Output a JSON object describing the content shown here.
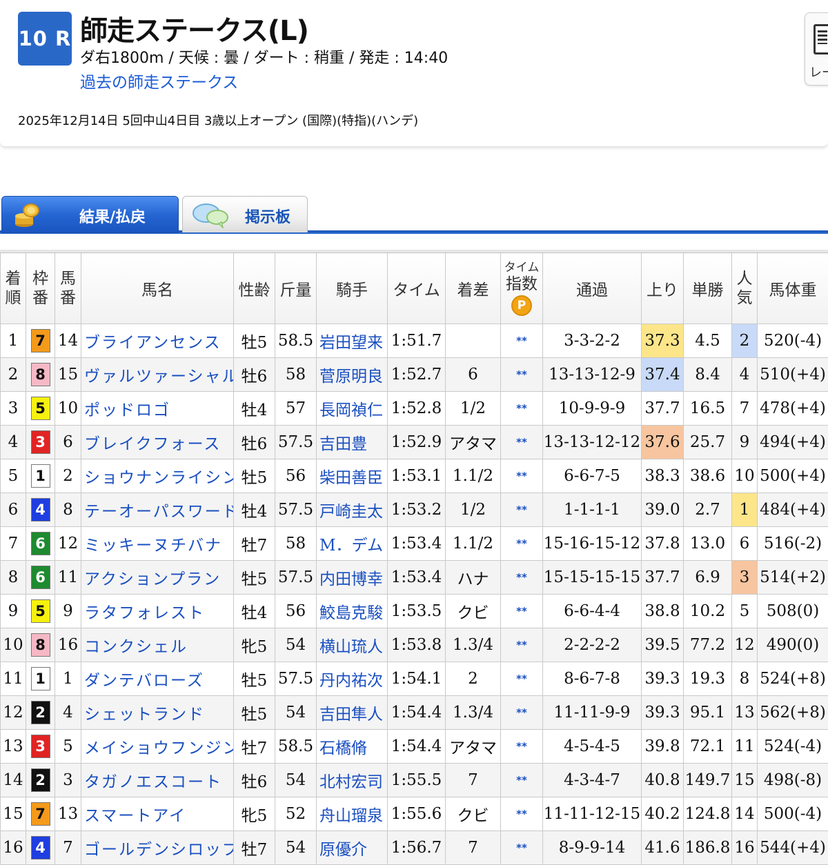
{
  "header": {
    "race_number": "10 R",
    "title": "師走ステークス(L)",
    "conditions": "ダ右1800m /  天候 : 曇 /  ダート : 稍重  /  発走 : 14:40",
    "past_link": "過去の師走ステークス",
    "meta": "2025年12月14日 5回中山4日目 3歳以上オープン  (国際)(特指)(ハンデ)",
    "side_widget_label": "レー"
  },
  "tabs": [
    {
      "label": "結果/払戻",
      "icon": "coins-icon",
      "active": true
    },
    {
      "label": "掲示板",
      "icon": "speech-bubble-icon",
      "active": false
    }
  ],
  "table": {
    "headers": {
      "rank": [
        "着",
        "順"
      ],
      "waku": [
        "枠",
        "番"
      ],
      "umaban": [
        "馬",
        "番"
      ],
      "horse": "馬名",
      "sex_age": "性齢",
      "weight": "斤量",
      "jockey": "騎手",
      "time": "タイム",
      "margin": "着差",
      "time_index": [
        "タイム",
        "指数"
      ],
      "time_index_badge": "P",
      "passing": "通過",
      "last3f": "上り",
      "odds": "単勝",
      "popularity": [
        "人",
        "気"
      ],
      "body_weight": "馬体重"
    },
    "highlight_colors": {
      "yellow": "#fde58a",
      "blue": "#c8daf8",
      "orange": "#f7c59f"
    },
    "rows": [
      {
        "rank": "1",
        "waku": "7",
        "umaban": "14",
        "horse": "ブライアンセンス",
        "sex_age": "牡5",
        "weight": "58.5",
        "jockey": "岩田望来",
        "time": "1:51.7",
        "margin": "",
        "index": "**",
        "passing": "3-3-2-2",
        "last3f": "37.3",
        "odds": "4.5",
        "pop": "2",
        "body": "520(-4)",
        "last3f_hl": "yellow",
        "pop_hl": "blue"
      },
      {
        "rank": "2",
        "waku": "8",
        "umaban": "15",
        "horse": "ヴァルツァーシャル",
        "sex_age": "牡6",
        "weight": "58",
        "jockey": "菅原明良",
        "time": "1:52.7",
        "margin": "6",
        "index": "**",
        "passing": "13-13-12-9",
        "last3f": "37.4",
        "odds": "8.4",
        "pop": "4",
        "body": "510(+4)",
        "last3f_hl": "blue",
        "pop_hl": ""
      },
      {
        "rank": "3",
        "waku": "5",
        "umaban": "10",
        "horse": "ポッドロゴ",
        "sex_age": "牡4",
        "weight": "57",
        "jockey": "長岡禎仁",
        "time": "1:52.8",
        "margin": "1/2",
        "index": "**",
        "passing": "10-9-9-9",
        "last3f": "37.7",
        "odds": "16.5",
        "pop": "7",
        "body": "478(+4)",
        "last3f_hl": "",
        "pop_hl": ""
      },
      {
        "rank": "4",
        "waku": "3",
        "umaban": "6",
        "horse": "ブレイクフォース",
        "sex_age": "牡6",
        "weight": "57.5",
        "jockey": "吉田豊",
        "time": "1:52.9",
        "margin": "アタマ",
        "index": "**",
        "passing": "13-13-12-12",
        "last3f": "37.6",
        "odds": "25.7",
        "pop": "9",
        "body": "494(+4)",
        "last3f_hl": "orange",
        "pop_hl": ""
      },
      {
        "rank": "5",
        "waku": "1",
        "umaban": "2",
        "horse": "ショウナンライシン",
        "sex_age": "牡5",
        "weight": "56",
        "jockey": "柴田善臣",
        "time": "1:53.1",
        "margin": "1.1/2",
        "index": "**",
        "passing": "6-6-7-5",
        "last3f": "38.3",
        "odds": "38.6",
        "pop": "10",
        "body": "500(+4)",
        "last3f_hl": "",
        "pop_hl": ""
      },
      {
        "rank": "6",
        "waku": "4",
        "umaban": "8",
        "horse": "テーオーパスワード",
        "sex_age": "牡4",
        "weight": "57.5",
        "jockey": "戸崎圭太",
        "time": "1:53.2",
        "margin": "1/2",
        "index": "**",
        "passing": "1-1-1-1",
        "last3f": "39.0",
        "odds": "2.7",
        "pop": "1",
        "body": "484(+4)",
        "last3f_hl": "",
        "pop_hl": "yellow"
      },
      {
        "rank": "7",
        "waku": "6",
        "umaban": "12",
        "horse": "ミッキーヌチバナ",
        "sex_age": "牡7",
        "weight": "58",
        "jockey": "M．デム",
        "time": "1:53.4",
        "margin": "1.1/2",
        "index": "**",
        "passing": "15-16-15-12",
        "last3f": "37.8",
        "odds": "13.0",
        "pop": "6",
        "body": "516(-2)",
        "last3f_hl": "",
        "pop_hl": ""
      },
      {
        "rank": "8",
        "waku": "6",
        "umaban": "11",
        "horse": "アクションプラン",
        "sex_age": "牡5",
        "weight": "57.5",
        "jockey": "内田博幸",
        "time": "1:53.4",
        "margin": "ハナ",
        "index": "**",
        "passing": "15-15-15-15",
        "last3f": "37.7",
        "odds": "6.9",
        "pop": "3",
        "body": "514(+2)",
        "last3f_hl": "",
        "pop_hl": "orange"
      },
      {
        "rank": "9",
        "waku": "5",
        "umaban": "9",
        "horse": "ラタフォレスト",
        "sex_age": "牡4",
        "weight": "56",
        "jockey": "鮫島克駿",
        "time": "1:53.5",
        "margin": "クビ",
        "index": "**",
        "passing": "6-6-4-4",
        "last3f": "38.8",
        "odds": "10.2",
        "pop": "5",
        "body": "508(0)",
        "last3f_hl": "",
        "pop_hl": ""
      },
      {
        "rank": "10",
        "waku": "8",
        "umaban": "16",
        "horse": "コンクシェル",
        "sex_age": "牝5",
        "weight": "54",
        "jockey": "横山琉人",
        "time": "1:53.8",
        "margin": "1.3/4",
        "index": "**",
        "passing": "2-2-2-2",
        "last3f": "39.5",
        "odds": "77.2",
        "pop": "12",
        "body": "490(0)",
        "last3f_hl": "",
        "pop_hl": ""
      },
      {
        "rank": "11",
        "waku": "1",
        "umaban": "1",
        "horse": "ダンテバローズ",
        "sex_age": "牡5",
        "weight": "57.5",
        "jockey": "丹内祐次",
        "time": "1:54.1",
        "margin": "2",
        "index": "**",
        "passing": "8-6-7-8",
        "last3f": "39.3",
        "odds": "19.3",
        "pop": "8",
        "body": "524(+8)",
        "last3f_hl": "",
        "pop_hl": ""
      },
      {
        "rank": "12",
        "waku": "2",
        "umaban": "4",
        "horse": "シェットランド",
        "sex_age": "牡5",
        "weight": "54",
        "jockey": "吉田隼人",
        "time": "1:54.4",
        "margin": "1.3/4",
        "index": "**",
        "passing": "11-11-9-9",
        "last3f": "39.3",
        "odds": "95.1",
        "pop": "13",
        "body": "562(+8)",
        "last3f_hl": "",
        "pop_hl": ""
      },
      {
        "rank": "13",
        "waku": "3",
        "umaban": "5",
        "horse": "メイショウフンジン",
        "sex_age": "牡7",
        "weight": "58.5",
        "jockey": "石橋脩",
        "time": "1:54.4",
        "margin": "アタマ",
        "index": "**",
        "passing": "4-5-4-5",
        "last3f": "39.8",
        "odds": "72.1",
        "pop": "11",
        "body": "524(-4)",
        "last3f_hl": "",
        "pop_hl": ""
      },
      {
        "rank": "14",
        "waku": "2",
        "umaban": "3",
        "horse": "タガノエスコート",
        "sex_age": "牡6",
        "weight": "54",
        "jockey": "北村宏司",
        "time": "1:55.5",
        "margin": "7",
        "index": "**",
        "passing": "4-3-4-7",
        "last3f": "40.8",
        "odds": "149.7",
        "pop": "15",
        "body": "498(-8)",
        "last3f_hl": "",
        "pop_hl": ""
      },
      {
        "rank": "15",
        "waku": "7",
        "umaban": "13",
        "horse": "スマートアイ",
        "sex_age": "牝5",
        "weight": "52",
        "jockey": "舟山瑠泉",
        "time": "1:55.6",
        "margin": "クビ",
        "index": "**",
        "passing": "11-11-12-15",
        "last3f": "40.2",
        "odds": "124.8",
        "pop": "14",
        "body": "500(-4)",
        "last3f_hl": "",
        "pop_hl": ""
      },
      {
        "rank": "16",
        "waku": "4",
        "umaban": "7",
        "horse": "ゴールデンシロップ",
        "sex_age": "牡7",
        "weight": "54",
        "jockey": "原優介",
        "time": "1:56.7",
        "margin": "7",
        "index": "**",
        "passing": "8-9-9-14",
        "last3f": "41.6",
        "odds": "186.8",
        "pop": "16",
        "body": "544(+4)",
        "last3f_hl": "",
        "pop_hl": ""
      }
    ]
  }
}
